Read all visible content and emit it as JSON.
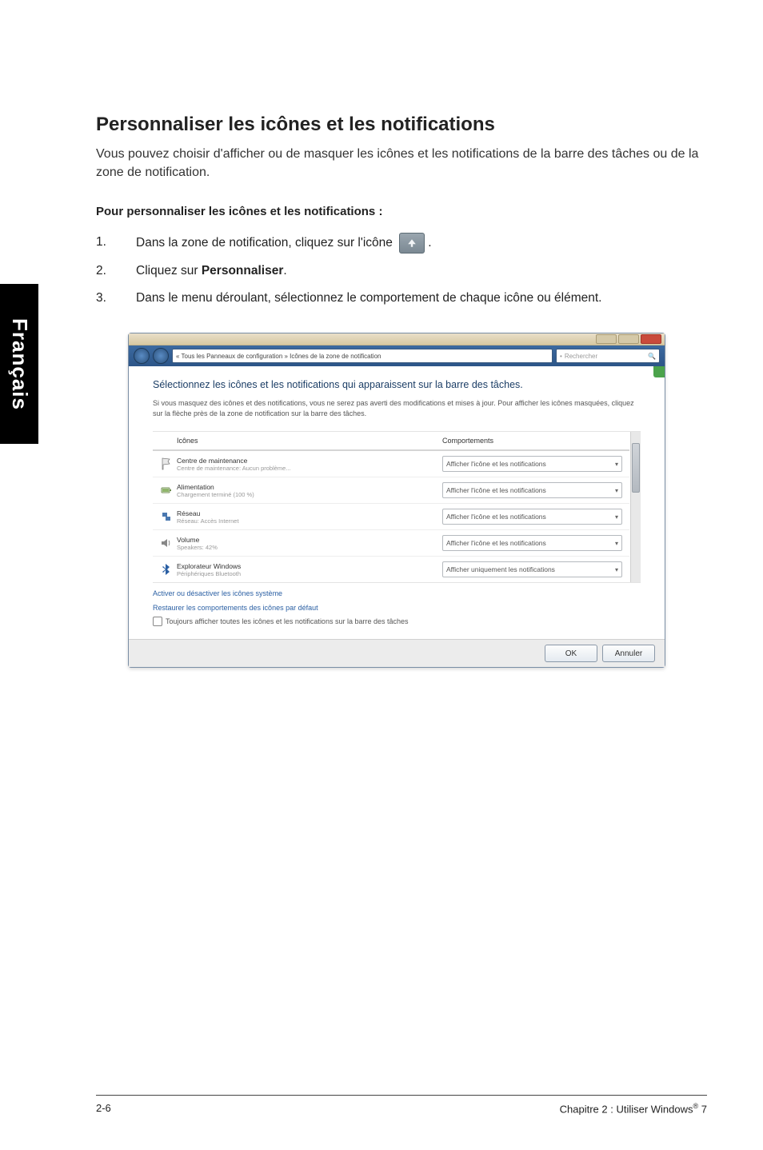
{
  "side_tab": {
    "label": "Français"
  },
  "section": {
    "title": "Personnaliser les icônes et les notifications",
    "intro": "Vous pouvez choisir d'afficher ou de masquer les icônes et les notifications de la barre des tâches ou de la zone de notification.",
    "subtitle": "Pour personnaliser les icônes et les notifications :",
    "steps": {
      "s1a": "Dans la zone de notification, cliquez sur l'icône ",
      "s1b": ".",
      "s2a": "Cliquez sur ",
      "s2_bold": "Personnaliser",
      "s2b": ".",
      "s3": "Dans le menu déroulant, sélectionnez le comportement de chaque icône ou élément."
    }
  },
  "window": {
    "breadcrumb": "« Tous les Panneaux de configuration » Icônes de la zone de notification",
    "search_placeholder": "Rechercher",
    "heading": "Sélectionnez les icônes et les notifications qui apparaissent sur la barre des tâches.",
    "description": "Si vous masquez des icônes et des notifications, vous ne serez pas averti des modifications et mises à jour. Pour afficher les icônes masquées, cliquez sur la flèche près de la zone de notification sur la barre des tâches.",
    "columns": {
      "c1": "Icônes",
      "c2": "Comportements"
    },
    "rows": [
      {
        "name": "Centre de maintenance",
        "sub": "Centre de maintenance: Aucun problème...",
        "behavior": "Afficher l'icône et les notifications"
      },
      {
        "name": "Alimentation",
        "sub": "Chargement terminé (100 %)",
        "behavior": "Afficher l'icône et les notifications"
      },
      {
        "name": "Réseau",
        "sub": "Réseau: Accès Internet",
        "behavior": "Afficher l'icône et les notifications"
      },
      {
        "name": "Volume",
        "sub": "Speakers: 42%",
        "behavior": "Afficher l'icône et les notifications"
      },
      {
        "name": "Explorateur Windows",
        "sub": "Périphériques Bluetooth",
        "behavior": "Afficher uniquement les notifications"
      }
    ],
    "link1": "Activer ou désactiver les icônes système",
    "link2": "Restaurer les comportements des icônes par défaut",
    "checkbox_label": "Toujours afficher toutes les icônes et les notifications sur la barre des tâches",
    "ok": "OK",
    "cancel": "Annuler"
  },
  "footer": {
    "left": "2-6",
    "right_a": "Chapitre 2 : Utiliser Windows",
    "right_sup": "®",
    "right_b": " 7"
  }
}
